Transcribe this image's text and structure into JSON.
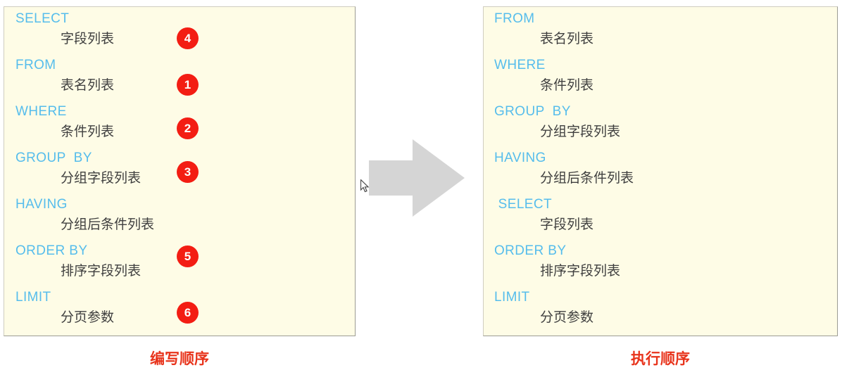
{
  "colors": {
    "panel_background": "#fefce6",
    "panel_border": "#cfcdc0",
    "keyword": "#56bdec",
    "value_text": "#3f3f3f",
    "badge": "#f31d13",
    "badge_text": "#ffffff",
    "caption": "#e8341c",
    "arrow": "#d5d5d5",
    "page_background": "#ffffff"
  },
  "left_panel": {
    "caption": "编写顺序",
    "clauses": [
      {
        "keyword": "SELECT",
        "value": "字段列表",
        "order": "4"
      },
      {
        "keyword": "FROM",
        "value": "表名列表",
        "order": "1"
      },
      {
        "keyword": "WHERE",
        "value": "条件列表",
        "order": "2"
      },
      {
        "keyword": "GROUP  BY",
        "value": "分组字段列表",
        "order": "3"
      },
      {
        "keyword": "HAVING",
        "value": "分组后条件列表",
        "order": ""
      },
      {
        "keyword": "ORDER BY",
        "value": "排序字段列表",
        "order": "5"
      },
      {
        "keyword": "LIMIT",
        "value": "分页参数",
        "order": "6"
      }
    ]
  },
  "right_panel": {
    "caption": "执行顺序",
    "clauses": [
      {
        "keyword": "FROM",
        "value": "表名列表"
      },
      {
        "keyword": "WHERE",
        "value": "条件列表"
      },
      {
        "keyword": "GROUP  BY",
        "value": "分组字段列表"
      },
      {
        "keyword": "HAVING",
        "value": "分组后条件列表"
      },
      {
        "keyword": " SELECT",
        "value": "字段列表"
      },
      {
        "keyword": "ORDER BY",
        "value": "排序字段列表"
      },
      {
        "keyword": "LIMIT",
        "value": "分页参数"
      }
    ]
  },
  "arrow": {
    "icon": "right-arrow-icon",
    "direction": "right"
  },
  "cursor": {
    "icon": "mouse-pointer-icon"
  }
}
